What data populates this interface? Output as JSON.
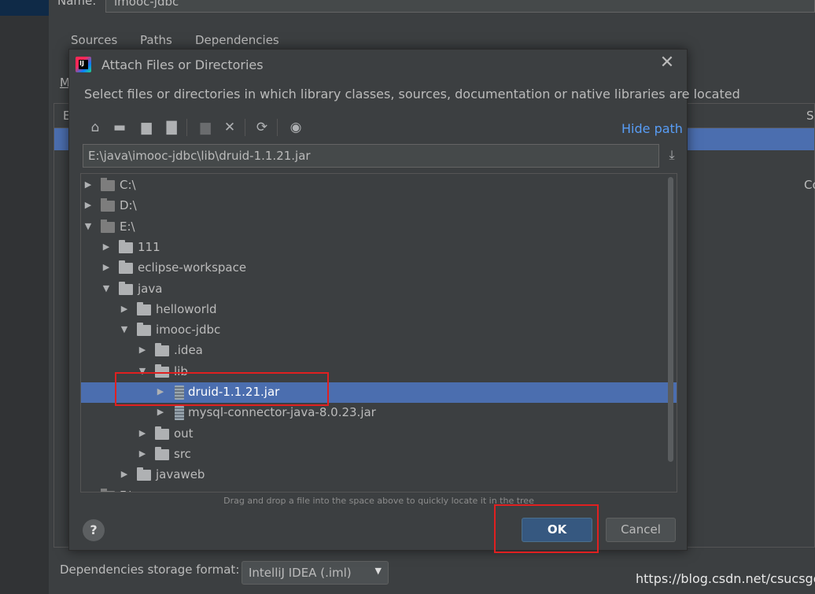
{
  "background": {
    "name_label": "Name:",
    "name_value": "imooc-jdbc",
    "tabs": [
      "Sources",
      "Paths",
      "Dependencies"
    ],
    "partial_m": "M",
    "partial_e": "E",
    "partial_s": "S",
    "partial_co": "Co",
    "storage_label": "Dependencies storage format:",
    "storage_value": "IntelliJ IDEA (.iml)",
    "watermark": "https://blog.csdn.net/csucsgoat"
  },
  "dialog": {
    "title": "Attach Files or Directories",
    "description": "Select files or directories in which library classes, sources, documentation or native libraries are located",
    "hide_path": "Hide path",
    "path_value": "E:\\java\\imooc-jdbc\\lib\\druid-1.1.21.jar",
    "toolbar_icons": [
      "home-icon",
      "desktop-icon",
      "project-icon",
      "module-icon",
      "new-folder-icon",
      "delete-icon",
      "refresh-icon",
      "show-hidden-icon"
    ],
    "tree": [
      {
        "label": "C:\\",
        "depth": 0,
        "type": "drive",
        "arrow": "collapsed"
      },
      {
        "label": "D:\\",
        "depth": 0,
        "type": "drive",
        "arrow": "collapsed"
      },
      {
        "label": "E:\\",
        "depth": 0,
        "type": "drive",
        "arrow": "expanded"
      },
      {
        "label": "111",
        "depth": 1,
        "type": "folder",
        "arrow": "collapsed"
      },
      {
        "label": "eclipse-workspace",
        "depth": 1,
        "type": "folder",
        "arrow": "collapsed"
      },
      {
        "label": "java",
        "depth": 1,
        "type": "folder",
        "arrow": "expanded"
      },
      {
        "label": "helloworld",
        "depth": 2,
        "type": "folder",
        "arrow": "collapsed"
      },
      {
        "label": "imooc-jdbc",
        "depth": 2,
        "type": "folder",
        "arrow": "expanded"
      },
      {
        "label": ".idea",
        "depth": 3,
        "type": "folder",
        "arrow": "collapsed"
      },
      {
        "label": "lib",
        "depth": 3,
        "type": "folder",
        "arrow": "expanded"
      },
      {
        "label": "druid-1.1.21.jar",
        "depth": 4,
        "type": "jar",
        "arrow": "collapsed",
        "selected": true
      },
      {
        "label": "mysql-connector-java-8.0.23.jar",
        "depth": 4,
        "type": "jar",
        "arrow": "collapsed"
      },
      {
        "label": "out",
        "depth": 3,
        "type": "folder",
        "arrow": "collapsed"
      },
      {
        "label": "src",
        "depth": 3,
        "type": "folder",
        "arrow": "collapsed"
      },
      {
        "label": "javaweb",
        "depth": 2,
        "type": "folder",
        "arrow": "collapsed"
      },
      {
        "label": "F:\\",
        "depth": 0,
        "type": "drive",
        "arrow": "collapsed"
      }
    ],
    "drag_hint": "Drag and drop a file into the space above to quickly locate it in the tree",
    "help_label": "?",
    "ok_label": "OK",
    "cancel_label": "Cancel"
  },
  "colors": {
    "background": "#3c3f41",
    "selection": "#4b6eaf",
    "link": "#589df6",
    "primary_button": "#365880",
    "highlight_box": "#e02020"
  }
}
